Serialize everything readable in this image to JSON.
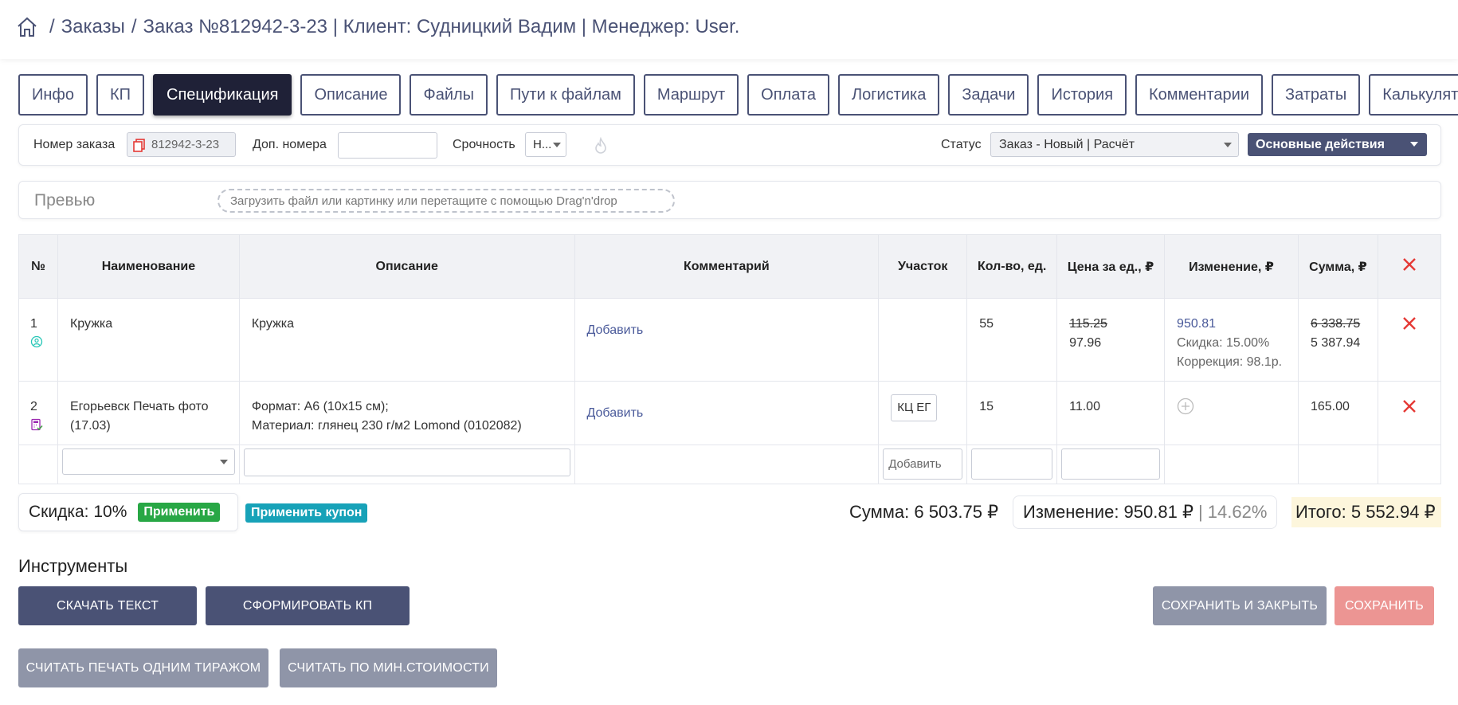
{
  "breadcrumb": {
    "items": [
      "Заказы",
      "Заказ №812942-3-23 | Клиент: Судницкий Вадим | Менеджер: User."
    ],
    "separator": "/"
  },
  "tabs": [
    {
      "label": "Инфо",
      "active": false
    },
    {
      "label": "КП",
      "active": false
    },
    {
      "label": "Спецификация",
      "active": true
    },
    {
      "label": "Описание",
      "active": false
    },
    {
      "label": "Файлы",
      "active": false
    },
    {
      "label": "Пути к файлам",
      "active": false
    },
    {
      "label": "Маршрут",
      "active": false
    },
    {
      "label": "Оплата",
      "active": false
    },
    {
      "label": "Логистика",
      "active": false
    },
    {
      "label": "Задачи",
      "active": false
    },
    {
      "label": "История",
      "active": false
    },
    {
      "label": "Комментарии",
      "active": false
    },
    {
      "label": "Затраты",
      "active": false
    },
    {
      "label": "Калькулятор",
      "active": false
    }
  ],
  "fields": {
    "order_number_label": "Номер заказа",
    "order_number_value": "812942-3-23",
    "extra_numbers_label": "Доп. номера",
    "extra_numbers_value": "",
    "urgency_label": "Срочность",
    "urgency_value": "Н...",
    "status_label": "Статус",
    "status_value": "Заказ - Новый | Расчёт",
    "main_actions_label": "Основные действия"
  },
  "preview": {
    "title": "Превью",
    "dropzone_text": "Загрузить файл или картинку или перетащите с помощью Drag'n'drop"
  },
  "table": {
    "headers": [
      "№",
      "Наименование",
      "Описание",
      "Комментарий",
      "Участок",
      "Кол-во, ед.",
      "Цена за ед., ₽",
      "Изменение, ₽",
      "Сумма, ₽"
    ],
    "rows": [
      {
        "num": "1",
        "name": "Кружка",
        "description": "Кружка",
        "comment_link": "Добавить",
        "area": "",
        "qty": "55",
        "price_old": "115.25",
        "price_new": "97.96",
        "change_value": "950.81",
        "change_discount": "Скидка: 15.00%",
        "change_correction": "Коррекция: 98.1р.",
        "sum_old": "6 338.75",
        "sum_new": "5 387.94"
      },
      {
        "num": "2",
        "name": "Егорьевск Печать фото (17.03)",
        "description_line1": "Формат: А6 (10x15 см);",
        "description_line2": "Материал: глянец 230 г/м2 Lomond (0102082)",
        "comment_link": "Добавить",
        "area": "КЦ ЕГ",
        "qty": "15",
        "price": "11.00",
        "sum": "165.00"
      }
    ],
    "new_row": {
      "area_placeholder": "Добавить"
    }
  },
  "summary": {
    "discount_label": "Скидка: 10%",
    "apply_label": "Применить",
    "apply_coupon_label": "Применить купон",
    "sum_label": "Сумма: 6 503.75 ₽",
    "change_label": "Изменение: 950.81 ₽",
    "change_pct": "| 14.62%",
    "total_label": "Итого: 5 552.94 ₽"
  },
  "tools": {
    "title": "Инструменты",
    "download_text": "СКАЧАТЬ ТЕКСТ",
    "form_kp": "СФОРМИРОВАТЬ КП",
    "save_close": "СОХРАНИТЬ И ЗАКРЫТЬ",
    "save": "СОХРАНИТЬ",
    "calc_one_run": "СЧИТАТЬ ПЕЧАТЬ ОДНИМ ТИРАЖОМ",
    "calc_min_cost": "СЧИТАТЬ ПО МИН.СТОИМОСТИ"
  },
  "colors": {
    "accent": "#4a5275",
    "active_tab": "#1f2137",
    "delete": "#e53935",
    "green": "#28a745",
    "teal": "#17a2b8",
    "save_red": "#ec9593"
  }
}
